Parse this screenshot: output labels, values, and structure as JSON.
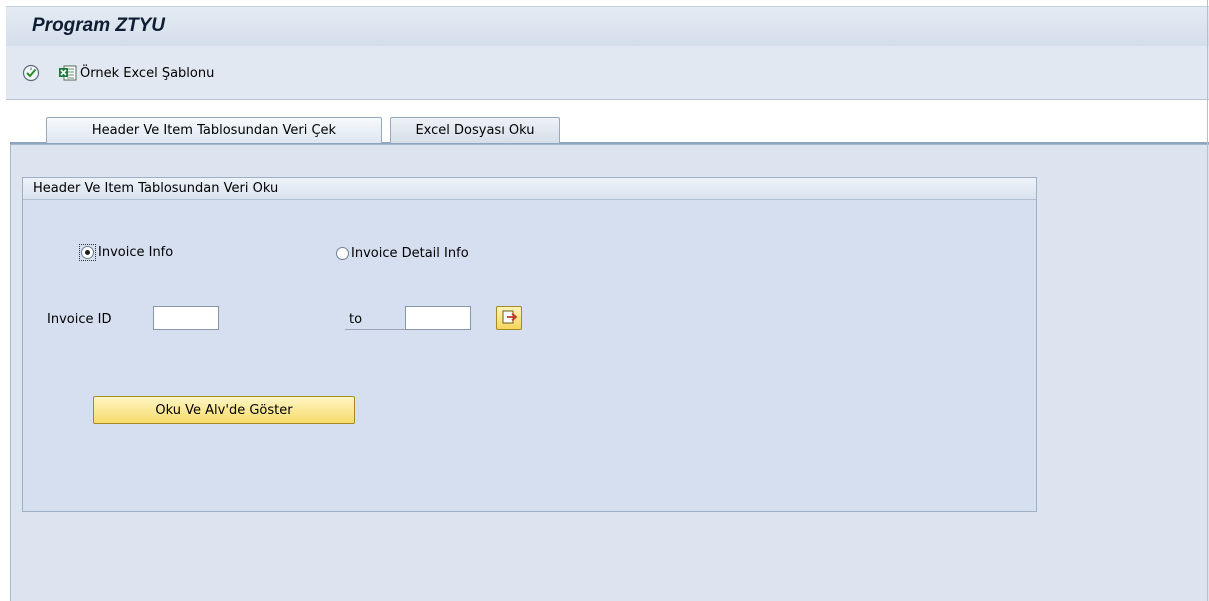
{
  "window": {
    "title": "Program ZTYU"
  },
  "toolbar": {
    "execute_icon": "execute-icon",
    "excel_icon": "excel-icon",
    "excel_label": "Örnek Excel Şablonu"
  },
  "tabs": [
    {
      "label": "Header Ve Item Tablosundan Veri Çek",
      "active": true
    },
    {
      "label": "Excel Dosyası Oku",
      "active": false
    }
  ],
  "group": {
    "title": "Header Ve Item Tablosundan Veri Oku",
    "radios": [
      {
        "label": "Invoice Info",
        "checked": true
      },
      {
        "label": "Invoice Detail Info",
        "checked": false
      }
    ],
    "invoice_id": {
      "label": "Invoice ID",
      "to_label": "to",
      "from_value": "",
      "to_value": "",
      "multi_select_icon": "multiple-selection-icon"
    },
    "action_button_label": "Oku Ve Alv'de Göster"
  },
  "colors": {
    "button_yellow": "#f6db6a",
    "panel_blue": "#dce4ef",
    "tab_underline": "#8fa6c1"
  }
}
